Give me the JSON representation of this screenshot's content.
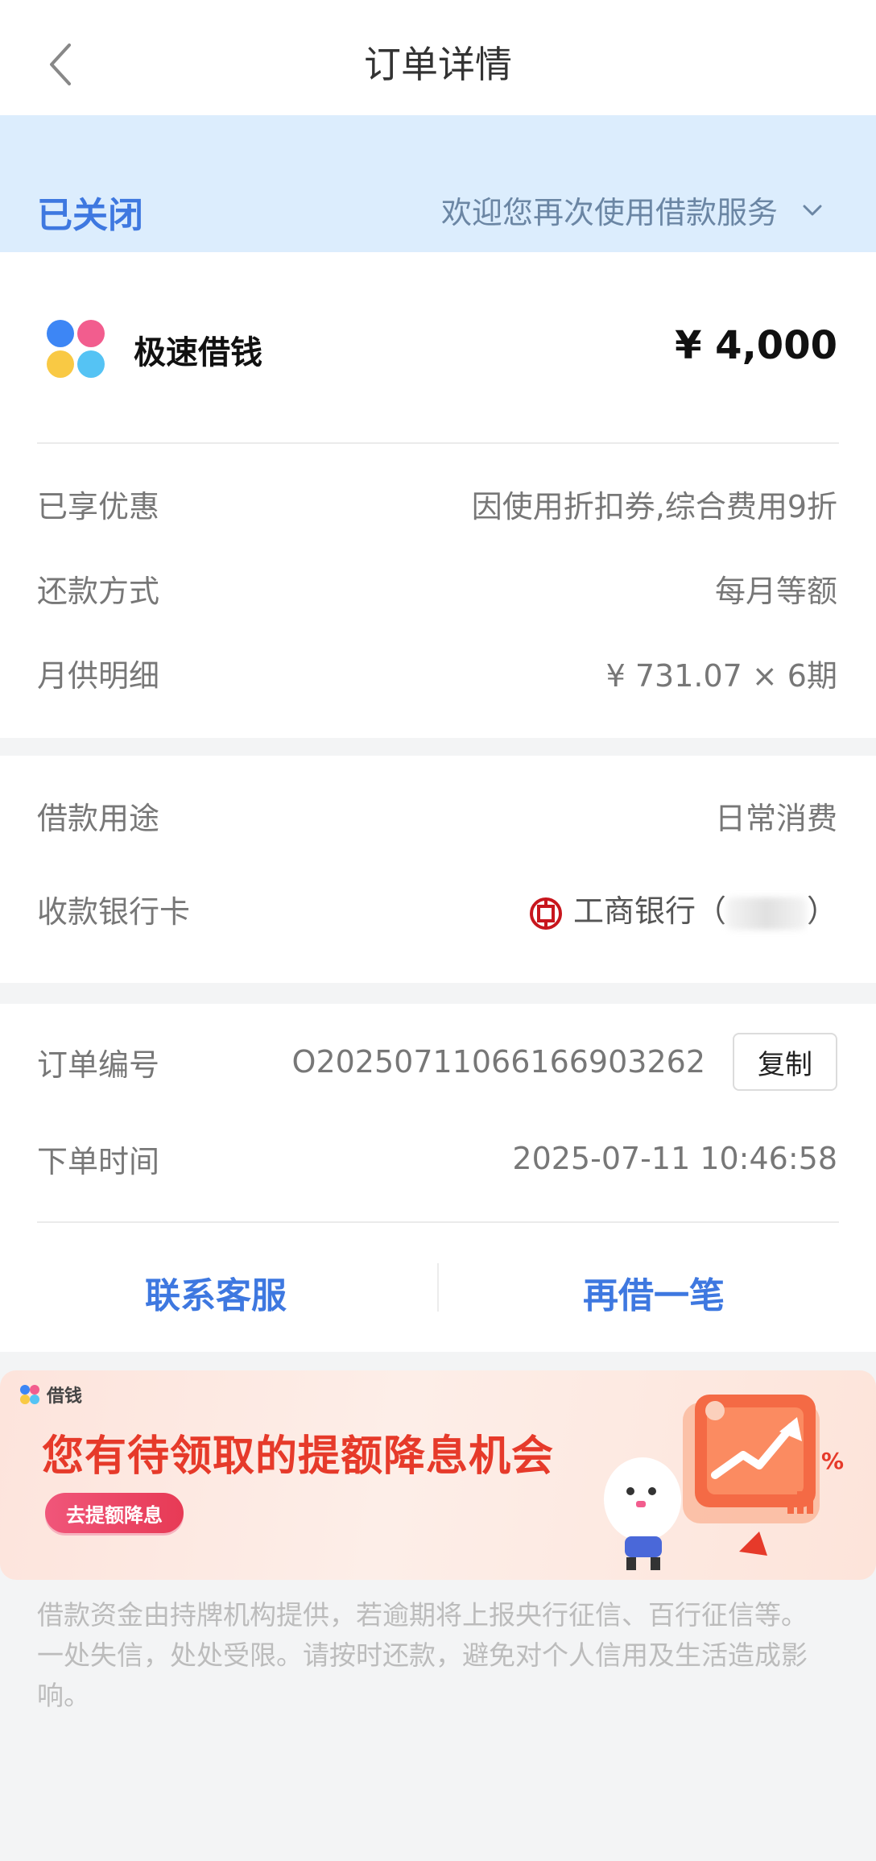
{
  "nav": {
    "title": "订单详情"
  },
  "status": {
    "label": "已关闭",
    "message": "欢迎您再次使用借款服务"
  },
  "product": {
    "name": "极速借钱",
    "amount": "¥ 4,000"
  },
  "details": [
    {
      "key": "已享优惠",
      "value": "因使用折扣券,综合费用9折"
    },
    {
      "key": "还款方式",
      "value": "每月等额"
    },
    {
      "key": "月供明细",
      "value": "¥ 731.07 × 6期"
    }
  ],
  "loan": {
    "purpose_key": "借款用途",
    "purpose_value": "日常消费",
    "card_key": "收款银行卡",
    "bank_name": "工商银行（",
    "bank_suffix": "）"
  },
  "order": {
    "number_key": "订单编号",
    "number_value": "O2025071106616690326​2",
    "copy_label": "复制",
    "time_key": "下单时间",
    "time_value": "2025-07-11 10:46:58"
  },
  "actions": {
    "service": "联系客服",
    "borrow_again": "再借一笔"
  },
  "banner": {
    "brand": "借钱",
    "title": "您有待领取的提额降息机会",
    "button": "去提额降息"
  },
  "disclaimer": "借款资金由持牌机构提供，若逾期将上报央行征信、百行征信等。一处失信，处处受限。请按时还款，避免对个人信用及生活造成影响。",
  "colors": {
    "accent": "#3e78e0",
    "status_bg": "#dcedfd",
    "banner_red": "#e63a2a"
  }
}
